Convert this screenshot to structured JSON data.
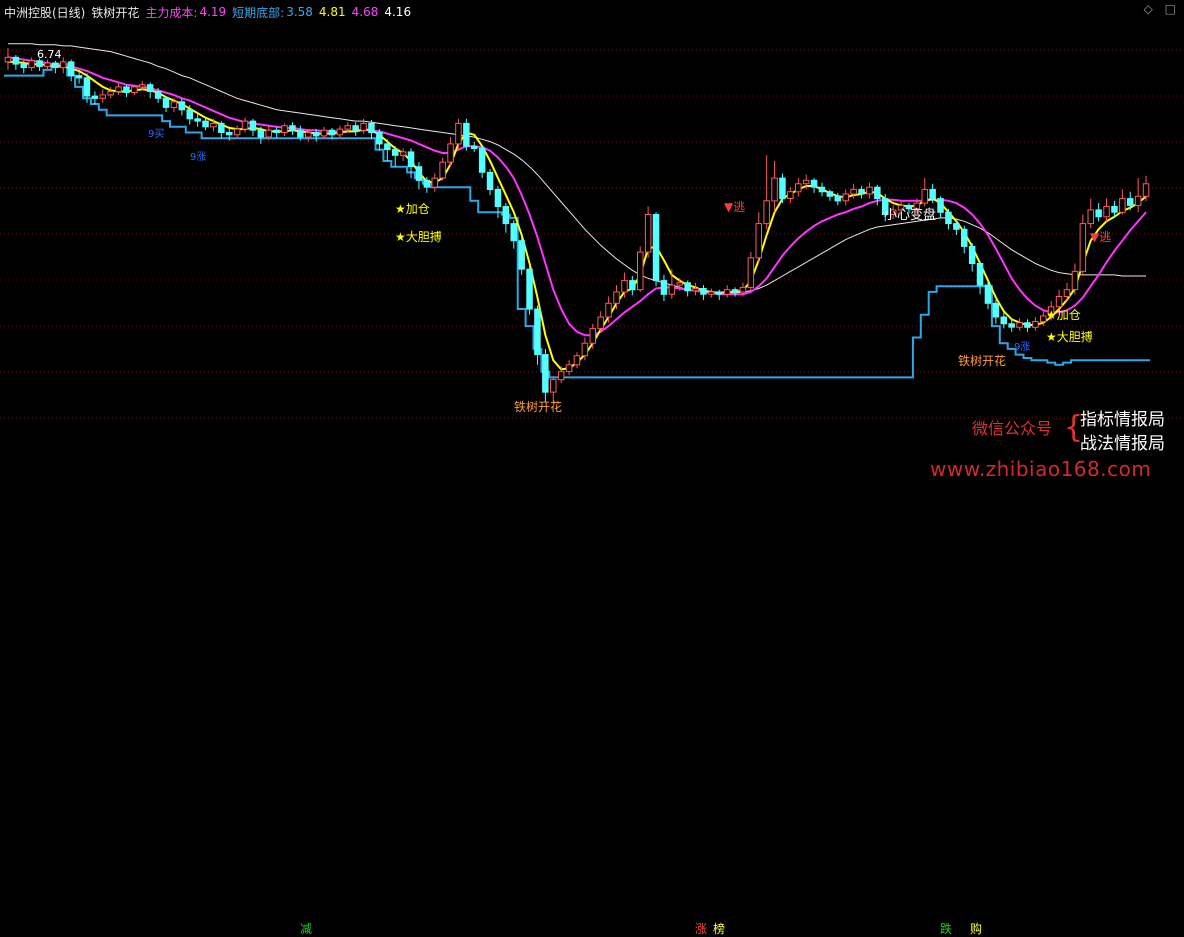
{
  "header": {
    "stock_title": "中洲控股(日线)",
    "indicator_name": "铁树开花",
    "cost_label": "主力成本:",
    "cost_value": "4.19",
    "bottom_label": "短期底部:",
    "bottom_v1": "3.58",
    "bottom_v2": "4.81",
    "bottom_v3": "4.68",
    "bottom_v4": "4.16"
  },
  "top_right_icons": [
    "diamond-icon",
    "square-icon"
  ],
  "colors": {
    "background": "#000000",
    "bull": "#ff5a5a",
    "bear": "#54ffff",
    "fast_line": "#ffff00",
    "mid_line": "#ff33ff",
    "slow_line": "#e8e8e8",
    "support_line": "#2aa8e8",
    "grid": "#7a1010"
  },
  "annotations": {
    "price_high": "6.74",
    "add_position": "★加仓",
    "bold_fight": "★大胆搏",
    "iron_tree": "铁树开花",
    "escape": "▼逃",
    "caution": "小心变盘",
    "buy": "买",
    "buy_marker_text": "9买",
    "buy_marker_text_2": "9涨"
  },
  "watermark": {
    "line_main": "微信公众号",
    "line_a": "指标情报局",
    "line_b": "战法情报局",
    "url": "www.zhibiao168.com"
  },
  "footer_flags": [
    "减",
    "涨",
    "榜",
    "跌",
    "购"
  ],
  "chart_data": {
    "type": "candlestick",
    "ylim": [
      3.3,
      6.9
    ],
    "grid": "dotted horizontal",
    "candles": [
      [
        6.62,
        6.66,
        6.55,
        6.74
      ],
      [
        6.66,
        6.6,
        6.55,
        6.68
      ],
      [
        6.6,
        6.57,
        6.52,
        6.63
      ],
      [
        6.57,
        6.63,
        6.54,
        6.66
      ],
      [
        6.63,
        6.58,
        6.54,
        6.65
      ],
      [
        6.58,
        6.61,
        6.55,
        6.64
      ],
      [
        6.61,
        6.57,
        6.52,
        6.63
      ],
      [
        6.57,
        6.62,
        6.52,
        6.66
      ],
      [
        6.62,
        6.5,
        6.45,
        6.64
      ],
      [
        6.5,
        6.48,
        6.43,
        6.53
      ],
      [
        6.48,
        6.32,
        6.26,
        6.52
      ],
      [
        6.32,
        6.3,
        6.25,
        6.36
      ],
      [
        6.3,
        6.33,
        6.26,
        6.38
      ],
      [
        6.33,
        6.36,
        6.3,
        6.4
      ],
      [
        6.36,
        6.4,
        6.33,
        6.43
      ],
      [
        6.4,
        6.35,
        6.31,
        6.42
      ],
      [
        6.35,
        6.4,
        6.33,
        6.42
      ],
      [
        6.4,
        6.42,
        6.37,
        6.45
      ],
      [
        6.42,
        6.36,
        6.3,
        6.44
      ],
      [
        6.36,
        6.3,
        6.26,
        6.39
      ],
      [
        6.3,
        6.22,
        6.18,
        6.32
      ],
      [
        6.22,
        6.27,
        6.18,
        6.3
      ],
      [
        6.27,
        6.2,
        6.15,
        6.3
      ],
      [
        6.2,
        6.12,
        6.07,
        6.24
      ],
      [
        6.12,
        6.1,
        6.05,
        6.16
      ],
      [
        6.1,
        6.05,
        6.02,
        6.14
      ],
      [
        6.05,
        6.08,
        6.01,
        6.12
      ],
      [
        6.08,
        6.0,
        5.95,
        6.1
      ],
      [
        6.0,
        5.98,
        5.93,
        6.03
      ],
      [
        5.98,
        6.03,
        5.95,
        6.06
      ],
      [
        6.03,
        6.1,
        6.0,
        6.13
      ],
      [
        6.1,
        6.02,
        5.97,
        6.12
      ],
      [
        6.02,
        5.96,
        5.9,
        6.05
      ],
      [
        5.96,
        6.02,
        5.93,
        6.06
      ],
      [
        6.02,
        6.0,
        5.95,
        6.05
      ],
      [
        6.0,
        6.06,
        5.97,
        6.08
      ],
      [
        6.06,
        6.02,
        5.98,
        6.09
      ],
      [
        6.02,
        5.96,
        5.93,
        6.06
      ],
      [
        5.96,
        6.0,
        5.92,
        6.03
      ],
      [
        6.0,
        5.97,
        5.92,
        6.03
      ],
      [
        5.97,
        6.02,
        5.94,
        6.05
      ],
      [
        6.02,
        5.98,
        5.94,
        6.04
      ],
      [
        5.98,
        6.03,
        5.95,
        6.06
      ],
      [
        6.03,
        6.06,
        6.0,
        6.09
      ],
      [
        6.06,
        6.02,
        5.97,
        6.09
      ],
      [
        6.02,
        6.08,
        5.99,
        6.12
      ],
      [
        6.08,
        6.0,
        5.94,
        6.11
      ],
      [
        6.0,
        5.9,
        5.84,
        6.03
      ],
      [
        5.9,
        5.85,
        5.75,
        5.94
      ],
      [
        5.85,
        5.8,
        5.7,
        5.88
      ],
      [
        5.8,
        5.83,
        5.75,
        5.86
      ],
      [
        5.83,
        5.7,
        5.6,
        5.86
      ],
      [
        5.7,
        5.58,
        5.5,
        5.74
      ],
      [
        5.58,
        5.52,
        5.47,
        5.61
      ],
      [
        5.52,
        5.6,
        5.48,
        5.64
      ],
      [
        5.6,
        5.74,
        5.58,
        5.78
      ],
      [
        5.74,
        5.9,
        5.7,
        5.96
      ],
      [
        5.9,
        6.08,
        5.86,
        6.12
      ],
      [
        6.08,
        5.88,
        5.84,
        6.12
      ],
      [
        5.88,
        5.86,
        5.83,
        5.92
      ],
      [
        5.86,
        5.65,
        5.6,
        5.88
      ],
      [
        5.65,
        5.5,
        5.45,
        5.68
      ],
      [
        5.5,
        5.35,
        5.25,
        5.53
      ],
      [
        5.35,
        5.2,
        5.12,
        5.38
      ],
      [
        5.2,
        5.05,
        4.98,
        5.23
      ],
      [
        5.05,
        4.8,
        4.75,
        5.08
      ],
      [
        4.8,
        4.45,
        4.4,
        4.83
      ],
      [
        4.45,
        4.05,
        3.96,
        4.48
      ],
      [
        4.05,
        3.72,
        3.63,
        4.1
      ],
      [
        3.72,
        3.83,
        3.62,
        3.86
      ],
      [
        3.83,
        3.9,
        3.8,
        3.95
      ],
      [
        3.9,
        3.96,
        3.87,
        4.0
      ],
      [
        3.96,
        4.04,
        3.93,
        4.07
      ],
      [
        4.04,
        4.15,
        4.0,
        4.2
      ],
      [
        4.15,
        4.28,
        4.1,
        4.32
      ],
      [
        4.28,
        4.38,
        4.24,
        4.43
      ],
      [
        4.38,
        4.5,
        4.33,
        4.56
      ],
      [
        4.5,
        4.6,
        4.45,
        4.66
      ],
      [
        4.6,
        4.7,
        4.55,
        4.77
      ],
      [
        4.7,
        4.62,
        4.57,
        4.74
      ],
      [
        4.62,
        4.95,
        4.6,
        5.0
      ],
      [
        4.95,
        5.28,
        4.9,
        5.35
      ],
      [
        5.28,
        4.7,
        4.65,
        5.3
      ],
      [
        4.7,
        4.58,
        4.52,
        4.75
      ],
      [
        4.58,
        4.66,
        4.54,
        4.8
      ],
      [
        4.66,
        4.68,
        4.61,
        4.72
      ],
      [
        4.68,
        4.61,
        4.56,
        4.7
      ],
      [
        4.61,
        4.63,
        4.57,
        4.68
      ],
      [
        4.63,
        4.58,
        4.53,
        4.66
      ],
      [
        4.58,
        4.6,
        4.55,
        4.63
      ],
      [
        4.6,
        4.58,
        4.53,
        4.62
      ],
      [
        4.58,
        4.62,
        4.55,
        4.66
      ],
      [
        4.62,
        4.6,
        4.56,
        4.64
      ],
      [
        4.6,
        4.64,
        4.56,
        4.68
      ],
      [
        4.64,
        4.9,
        4.6,
        4.95
      ],
      [
        4.9,
        5.2,
        4.86,
        5.3
      ],
      [
        5.2,
        5.4,
        5.15,
        5.8
      ],
      [
        5.4,
        5.6,
        5.3,
        5.75
      ],
      [
        5.6,
        5.42,
        5.38,
        5.64
      ],
      [
        5.42,
        5.48,
        5.38,
        5.52
      ],
      [
        5.48,
        5.55,
        5.44,
        5.6
      ],
      [
        5.55,
        5.58,
        5.5,
        5.63
      ],
      [
        5.58,
        5.52,
        5.47,
        5.6
      ],
      [
        5.52,
        5.48,
        5.44,
        5.56
      ],
      [
        5.48,
        5.44,
        5.4,
        5.5
      ],
      [
        5.44,
        5.4,
        5.36,
        5.47
      ],
      [
        5.4,
        5.46,
        5.36,
        5.5
      ],
      [
        5.46,
        5.5,
        5.42,
        5.55
      ],
      [
        5.5,
        5.46,
        5.42,
        5.53
      ],
      [
        5.46,
        5.52,
        5.42,
        5.56
      ],
      [
        5.52,
        5.42,
        5.36,
        5.54
      ],
      [
        5.42,
        5.28,
        5.22,
        5.46
      ],
      [
        5.28,
        5.32,
        5.24,
        5.36
      ],
      [
        5.32,
        5.36,
        5.28,
        5.39
      ],
      [
        5.36,
        5.33,
        5.29,
        5.38
      ],
      [
        5.33,
        5.38,
        5.29,
        5.42
      ],
      [
        5.38,
        5.5,
        5.35,
        5.6
      ],
      [
        5.5,
        5.42,
        5.38,
        5.55
      ],
      [
        5.42,
        5.3,
        5.25,
        5.44
      ],
      [
        5.3,
        5.2,
        5.15,
        5.33
      ],
      [
        5.2,
        5.15,
        5.1,
        5.22
      ],
      [
        5.15,
        5.0,
        4.94,
        5.18
      ],
      [
        5.0,
        4.85,
        4.78,
        5.03
      ],
      [
        4.85,
        4.66,
        4.58,
        4.87
      ],
      [
        4.66,
        4.5,
        4.45,
        4.7
      ],
      [
        4.5,
        4.38,
        4.32,
        4.53
      ],
      [
        4.38,
        4.32,
        4.28,
        4.42
      ],
      [
        4.32,
        4.29,
        4.25,
        4.36
      ],
      [
        4.29,
        4.33,
        4.26,
        4.37
      ],
      [
        4.33,
        4.29,
        4.25,
        4.36
      ],
      [
        4.29,
        4.34,
        4.26,
        4.38
      ],
      [
        4.34,
        4.39,
        4.3,
        4.44
      ],
      [
        4.39,
        4.47,
        4.35,
        4.52
      ],
      [
        4.47,
        4.56,
        4.42,
        4.62
      ],
      [
        4.56,
        4.62,
        4.52,
        4.68
      ],
      [
        4.62,
        4.78,
        4.58,
        4.85
      ],
      [
        4.78,
        5.2,
        4.75,
        5.28
      ],
      [
        5.2,
        5.32,
        5.16,
        5.42
      ],
      [
        5.32,
        5.26,
        5.22,
        5.38
      ],
      [
        5.26,
        5.35,
        5.22,
        5.42
      ],
      [
        5.35,
        5.3,
        5.26,
        5.4
      ],
      [
        5.3,
        5.42,
        5.28,
        5.5
      ],
      [
        5.42,
        5.36,
        5.32,
        5.48
      ],
      [
        5.36,
        5.44,
        5.3,
        5.6
      ],
      [
        5.44,
        5.55,
        5.4,
        5.62
      ]
    ],
    "fast_line": [
      6.62,
      6.62,
      6.61,
      6.6,
      6.6,
      6.59,
      6.58,
      6.58,
      6.56,
      6.54,
      6.5,
      6.45,
      6.4,
      6.37,
      6.36,
      6.36,
      6.37,
      6.38,
      6.37,
      6.35,
      6.31,
      6.28,
      6.25,
      6.21,
      6.17,
      6.13,
      6.1,
      6.07,
      6.04,
      6.03,
      6.03,
      6.04,
      6.03,
      6.01,
      6.01,
      6.01,
      6.02,
      6.01,
      6.0,
      5.99,
      5.99,
      5.99,
      6.0,
      6.01,
      6.01,
      6.03,
      6.02,
      5.98,
      5.92,
      5.86,
      5.82,
      5.75,
      5.65,
      5.57,
      5.56,
      5.6,
      5.72,
      5.9,
      6.0,
      5.98,
      5.88,
      5.75,
      5.6,
      5.45,
      5.3,
      5.1,
      4.85,
      4.55,
      4.22,
      4.0,
      3.92,
      3.93,
      3.98,
      4.05,
      4.15,
      4.27,
      4.38,
      4.5,
      4.6,
      4.63,
      4.75,
      4.98,
      5.0,
      4.88,
      4.75,
      4.7,
      4.66,
      4.64,
      4.61,
      4.6,
      4.59,
      4.6,
      4.6,
      4.61,
      4.7,
      4.88,
      5.1,
      5.3,
      5.42,
      5.46,
      5.5,
      5.53,
      5.53,
      5.5,
      5.47,
      5.44,
      5.43,
      5.45,
      5.46,
      5.48,
      5.47,
      5.42,
      5.38,
      5.36,
      5.35,
      5.36,
      5.4,
      5.42,
      5.38,
      5.3,
      5.22,
      5.12,
      5.0,
      4.85,
      4.7,
      4.55,
      4.43,
      4.36,
      4.33,
      4.31,
      4.31,
      4.33,
      4.38,
      4.45,
      4.53,
      4.63,
      4.85,
      5.05,
      5.15,
      5.22,
      5.26,
      5.31,
      5.34,
      5.38,
      5.44
    ],
    "mid_line": [
      6.66,
      6.65,
      6.64,
      6.63,
      6.62,
      6.61,
      6.6,
      6.59,
      6.58,
      6.56,
      6.54,
      6.51,
      6.48,
      6.46,
      6.44,
      6.42,
      6.41,
      6.4,
      6.39,
      6.37,
      6.35,
      6.33,
      6.3,
      6.28,
      6.25,
      6.22,
      6.19,
      6.16,
      6.13,
      6.11,
      6.09,
      6.08,
      6.07,
      6.06,
      6.05,
      6.04,
      6.04,
      6.03,
      6.02,
      6.02,
      6.01,
      6.01,
      6.01,
      6.01,
      6.01,
      6.02,
      6.02,
      6.01,
      5.99,
      5.97,
      5.95,
      5.93,
      5.9,
      5.87,
      5.84,
      5.82,
      5.82,
      5.85,
      5.88,
      5.88,
      5.87,
      5.84,
      5.78,
      5.7,
      5.6,
      5.45,
      5.28,
      5.08,
      4.85,
      4.62,
      4.45,
      4.32,
      4.25,
      4.22,
      4.22,
      4.25,
      4.3,
      4.36,
      4.42,
      4.47,
      4.52,
      4.58,
      4.63,
      4.64,
      4.64,
      4.63,
      4.62,
      4.61,
      4.6,
      4.59,
      4.58,
      4.58,
      4.58,
      4.58,
      4.6,
      4.65,
      4.72,
      4.82,
      4.92,
      5.0,
      5.07,
      5.13,
      5.18,
      5.22,
      5.25,
      5.28,
      5.3,
      5.33,
      5.35,
      5.38,
      5.4,
      5.41,
      5.41,
      5.4,
      5.4,
      5.4,
      5.4,
      5.41,
      5.41,
      5.4,
      5.38,
      5.34,
      5.28,
      5.2,
      5.1,
      4.98,
      4.85,
      4.72,
      4.62,
      4.54,
      4.48,
      4.44,
      4.42,
      4.42,
      4.44,
      4.48,
      4.55,
      4.65,
      4.75,
      4.86,
      4.96,
      5.05,
      5.14,
      5.22,
      5.3
    ],
    "slow_line": [
      6.78,
      6.78,
      6.78,
      6.78,
      6.77,
      6.77,
      6.77,
      6.76,
      6.76,
      6.75,
      6.74,
      6.73,
      6.72,
      6.71,
      6.69,
      6.67,
      6.65,
      6.63,
      6.61,
      6.58,
      6.56,
      6.53,
      6.5,
      6.48,
      6.45,
      6.42,
      6.39,
      6.36,
      6.33,
      6.3,
      6.28,
      6.26,
      6.24,
      6.22,
      6.2,
      6.19,
      6.18,
      6.17,
      6.16,
      6.15,
      6.14,
      6.13,
      6.12,
      6.11,
      6.1,
      6.1,
      6.09,
      6.08,
      6.07,
      6.06,
      6.05,
      6.04,
      6.03,
      6.02,
      6.01,
      6.0,
      5.99,
      5.98,
      5.97,
      5.96,
      5.94,
      5.92,
      5.89,
      5.85,
      5.81,
      5.76,
      5.7,
      5.63,
      5.55,
      5.47,
      5.39,
      5.31,
      5.23,
      5.15,
      5.08,
      5.01,
      4.95,
      4.89,
      4.84,
      4.79,
      4.75,
      4.72,
      4.7,
      4.68,
      4.66,
      4.64,
      4.62,
      4.61,
      4.6,
      4.59,
      4.59,
      4.59,
      4.59,
      4.6,
      4.61,
      4.63,
      4.66,
      4.7,
      4.74,
      4.78,
      4.82,
      4.86,
      4.9,
      4.94,
      4.98,
      5.02,
      5.06,
      5.09,
      5.12,
      5.15,
      5.17,
      5.18,
      5.19,
      5.2,
      5.21,
      5.22,
      5.23,
      5.24,
      5.25,
      5.25,
      5.24,
      5.22,
      5.19,
      5.16,
      5.12,
      5.07,
      5.02,
      4.97,
      4.93,
      4.89,
      4.85,
      4.82,
      4.79,
      4.77,
      4.76,
      4.75,
      4.75,
      4.75,
      4.75,
      4.75,
      4.75,
      4.74,
      4.74,
      4.74,
      4.74
    ],
    "support_line": [
      6.5,
      6.5,
      6.5,
      6.5,
      6.5,
      6.55,
      6.6,
      6.6,
      6.5,
      6.4,
      6.3,
      6.25,
      6.2,
      6.15,
      6.15,
      6.15,
      6.15,
      6.15,
      6.15,
      6.15,
      6.1,
      6.05,
      6.05,
      6.0,
      6.0,
      5.95,
      5.95,
      5.95,
      5.95,
      5.95,
      5.95,
      5.95,
      5.95,
      5.95,
      5.95,
      5.95,
      5.95,
      5.95,
      5.95,
      5.95,
      5.95,
      5.95,
      5.95,
      5.95,
      5.95,
      5.95,
      5.95,
      5.85,
      5.75,
      5.7,
      5.7,
      5.65,
      5.6,
      5.55,
      5.52,
      5.52,
      5.52,
      5.52,
      5.52,
      5.4,
      5.3,
      5.3,
      5.3,
      5.28,
      5.25,
      4.45,
      4.3,
      4.1,
      3.9,
      3.85,
      3.85,
      3.85,
      3.85,
      3.85,
      3.85,
      3.85,
      3.85,
      3.85,
      3.85,
      3.85,
      3.85,
      3.85,
      3.85,
      3.85,
      3.85,
      3.85,
      3.85,
      3.85,
      3.85,
      3.85,
      3.85,
      3.85,
      3.85,
      3.85,
      3.85,
      3.85,
      3.85,
      3.85,
      3.85,
      3.85,
      3.85,
      3.85,
      3.85,
      3.85,
      3.85,
      3.85,
      3.85,
      3.85,
      3.85,
      3.85,
      3.85,
      3.85,
      3.85,
      3.85,
      3.85,
      4.2,
      4.4,
      4.6,
      4.65,
      4.65,
      4.65,
      4.65,
      4.65,
      4.65,
      4.65,
      4.3,
      4.15,
      4.1,
      4.05,
      4.02,
      4.0,
      4.0,
      3.98,
      3.96,
      3.98,
      4.0,
      4.0,
      4.0,
      4.0,
      4.0,
      4.0,
      4.0,
      4.0,
      4.0,
      4.0
    ]
  }
}
